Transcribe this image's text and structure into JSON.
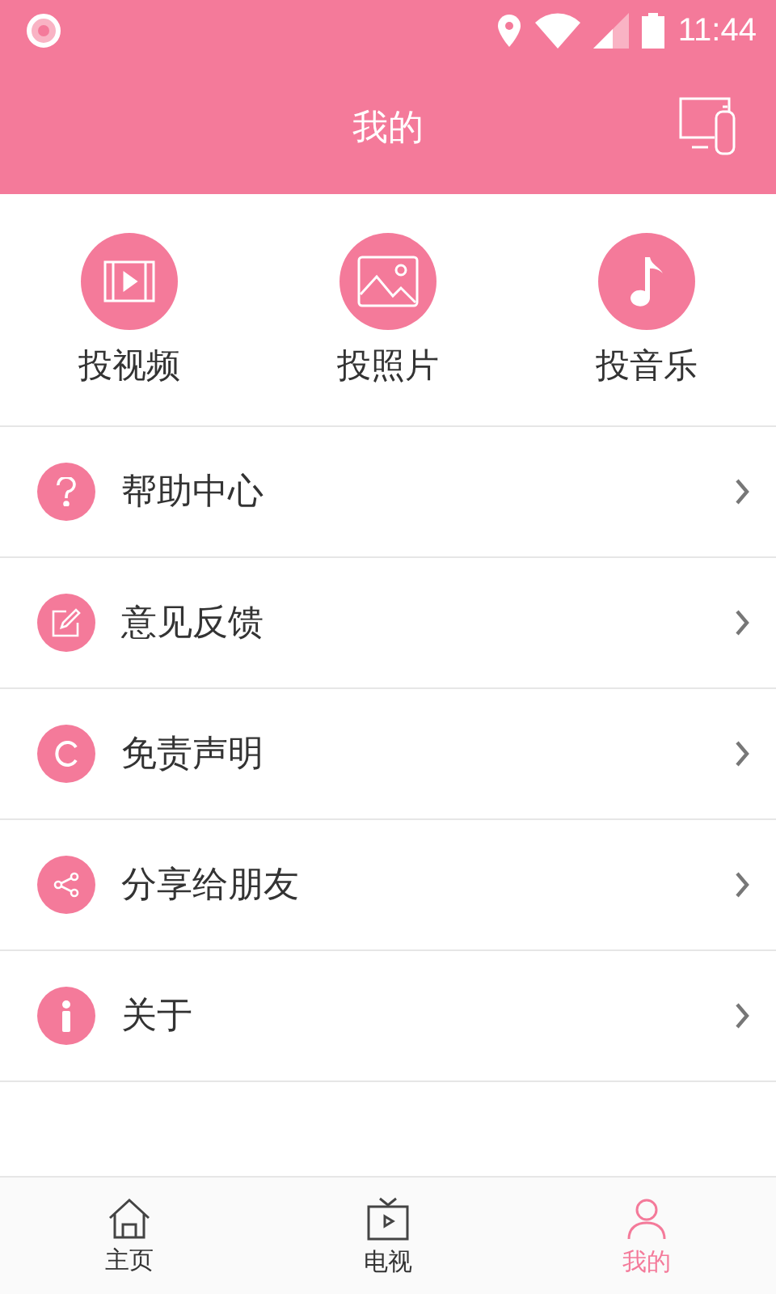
{
  "status_bar": {
    "time": "11:44"
  },
  "header": {
    "title": "我的"
  },
  "actions": [
    {
      "kind": "video",
      "label": "投视频"
    },
    {
      "kind": "photo",
      "label": "投照片"
    },
    {
      "kind": "music",
      "label": "投音乐"
    }
  ],
  "menu": [
    {
      "kind": "help",
      "label": "帮助中心"
    },
    {
      "kind": "feedback",
      "label": "意见反馈"
    },
    {
      "kind": "disclaimer",
      "label": "免责声明"
    },
    {
      "kind": "share",
      "label": "分享给朋友"
    },
    {
      "kind": "about",
      "label": "关于"
    }
  ],
  "tabs": [
    {
      "kind": "home",
      "label": "主页",
      "selected": false
    },
    {
      "kind": "tv",
      "label": "电视",
      "selected": false
    },
    {
      "kind": "me",
      "label": "我的",
      "selected": true
    }
  ]
}
